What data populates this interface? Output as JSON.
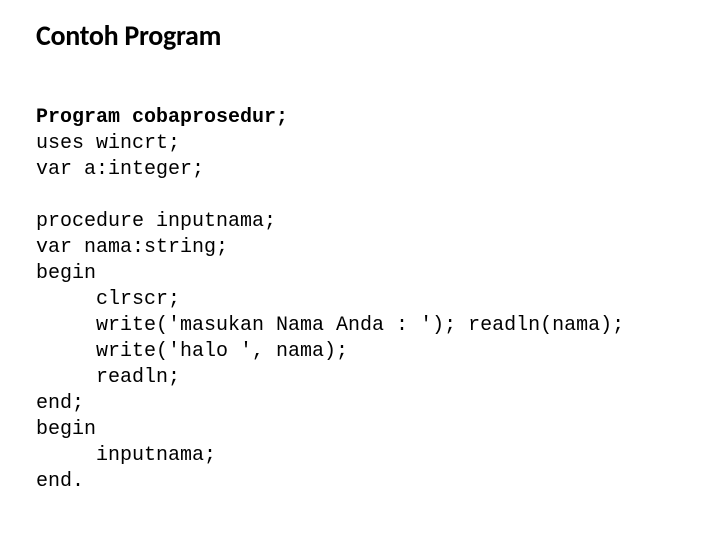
{
  "title": "Contoh Program",
  "code": {
    "l1": "Program cobaprosedur;",
    "l2": "uses wincrt;",
    "l3": "var a:integer;",
    "blank1": "",
    "l4": "procedure inputnama;",
    "l5": "var nama:string;",
    "l6": "begin",
    "l7": "     clrscr;",
    "l8": "     write('masukan Nama Anda : '); readln(nama);",
    "l9": "     write('halo ', nama);",
    "l10": "     readln;",
    "l11": "end;",
    "l12": "begin",
    "l13": "     inputnama;",
    "l14": "end."
  }
}
